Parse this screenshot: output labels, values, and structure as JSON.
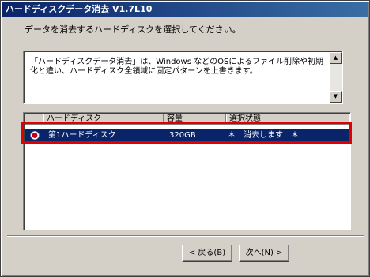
{
  "window": {
    "title": "ハードディスクデータ消去 V1.7L10"
  },
  "instruction": "データを消去するハードディスクを選択してください。",
  "description": "「ハードディスクデータ消去」は、Windows などのOSによるファイル削除や初期化と違い、ハードディスク全領域に固定パターンを上書きます。",
  "scroll": {
    "up_icon": "▲",
    "down_icon": "▼"
  },
  "list": {
    "columns": {
      "disk": "ハードディスク",
      "capacity": "容量",
      "status": "選択状態"
    },
    "rows": [
      {
        "disk": "第1ハードディスク",
        "capacity": "320GB",
        "status": "＊　消去します　＊",
        "selected": true
      }
    ]
  },
  "buttons": {
    "back": "< 戻る(B)",
    "next": "次へ(N) >"
  },
  "colors": {
    "selection": "#0a246a",
    "highlight_border": "#e00000",
    "titlebar": "#0a246a"
  }
}
